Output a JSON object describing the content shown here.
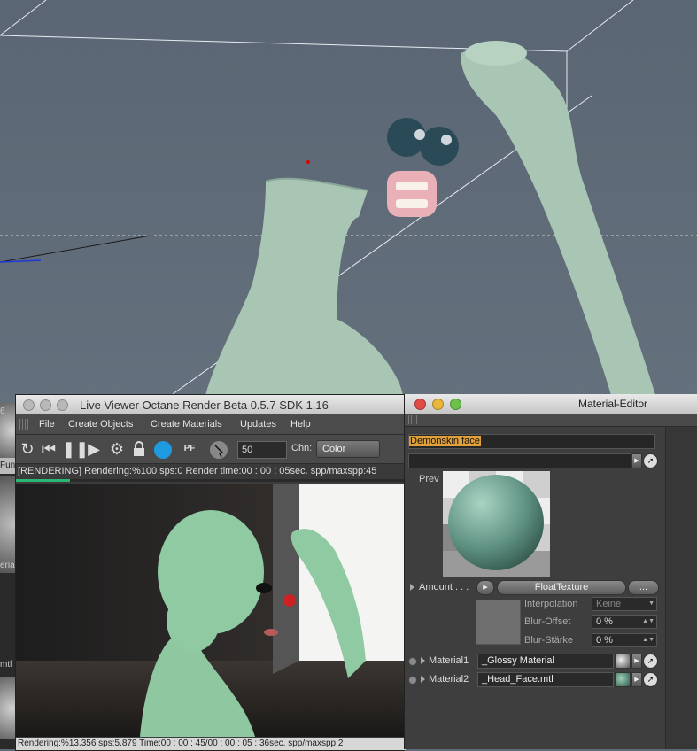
{
  "live_viewer": {
    "title": "Live Viewer     Octane Render Beta 0.5.7   SDK 1.16",
    "menu": [
      "File",
      "Create Objects",
      "Create Materials",
      "Updates",
      "Help"
    ],
    "samples_value": "50",
    "channel_label": "Chn:",
    "channel_value": "Color",
    "pf_label": "PF",
    "status_text": "[RENDERING]  Rendering:%100 sps:0 Render time:00 : 00 : 05sec. spp/maxspp:45",
    "bottom_status": "Rendering:%13.356 sps:5.879 Time:00 : 00 : 45/00 : 00 : 05 : 36sec. spp/maxspp:2",
    "progress_fraction": 0.14
  },
  "material_editor": {
    "title": "Material-Editor",
    "name_value": "Demonskin face",
    "preview_label": "Prev",
    "amount_label": "Amount . . .",
    "amount_button": "FloatTexture",
    "more_button": "...",
    "interpolation_label": "Interpolation",
    "interpolation_value": "Keine",
    "blur_offset_label": "Blur-Offset",
    "blur_offset_value": "0 %",
    "blur_strength_label": "Blur-Stärke",
    "blur_strength_value": "0 %",
    "material1_label": "Material1",
    "material1_value": "_Glossy Material",
    "material2_label": "Material2",
    "material2_value": "_Head_Face.mtl"
  },
  "left_stub": {
    "tab_text": "Fun",
    "label_a": "eria",
    "label_b": "mtl",
    "label_c": "6"
  }
}
